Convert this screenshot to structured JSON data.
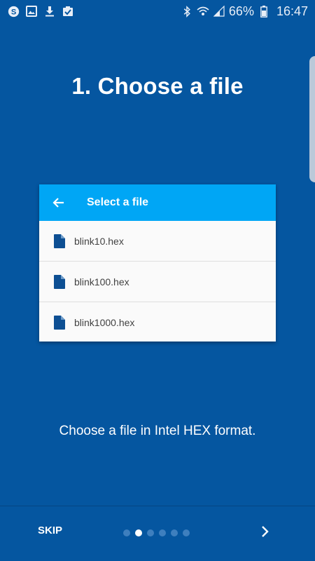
{
  "status_bar": {
    "battery_percent": "66%",
    "time": "16:47",
    "left_icons": [
      "skype-icon",
      "image-icon",
      "download-icon",
      "clipboard-check-icon"
    ],
    "right_icons": [
      "bluetooth-icon",
      "wifi-icon",
      "signal-icon",
      "battery-icon"
    ]
  },
  "page": {
    "title": "1. Choose a file",
    "description": "Choose a file in Intel HEX format."
  },
  "file_picker": {
    "title": "Select a file",
    "files": [
      {
        "name": "blink10.hex",
        "icon": "file-icon"
      },
      {
        "name": "blink100.hex",
        "icon": "file-icon"
      },
      {
        "name": "blink1000.hex",
        "icon": "file-icon"
      }
    ]
  },
  "navigation": {
    "skip_label": "SKIP",
    "total_pages": 6,
    "current_page": 2,
    "next_icon": "chevron-right-icon"
  },
  "colors": {
    "background": "#0556A0",
    "header": "#00A6F5",
    "card": "#FAFAFA",
    "file_icon": "#0D4F93"
  }
}
